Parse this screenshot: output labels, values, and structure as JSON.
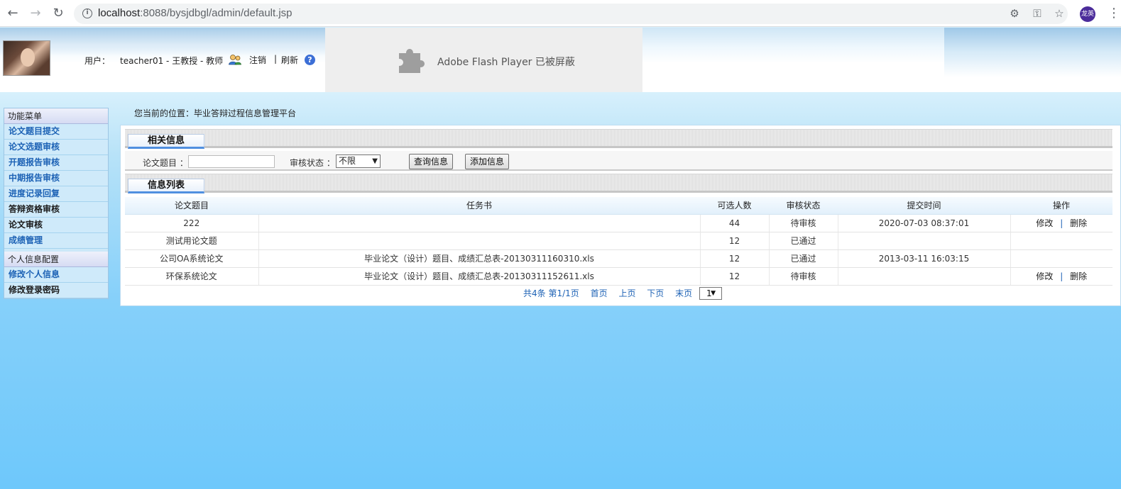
{
  "browser": {
    "url_host": "localhost",
    "url_rest": ":8088/bysjdbgl/admin/default.jsp",
    "profile_label": "龙英"
  },
  "header": {
    "user_label": "用户：",
    "user_name": "teacher01 - 王教授 - 教师",
    "logout": "注销",
    "separator": "|",
    "refresh": "刷新",
    "help": "?",
    "flash_message": "Adobe Flash Player 已被屏蔽"
  },
  "sidebar": {
    "sections": [
      {
        "title": "功能菜单",
        "items": [
          {
            "label": "论文题目提交",
            "style": "link"
          },
          {
            "label": "论文选题审核",
            "style": "link"
          },
          {
            "label": "开题报告审核",
            "style": "link"
          },
          {
            "label": "中期报告审核",
            "style": "link"
          },
          {
            "label": "进度记录回复",
            "style": "link"
          },
          {
            "label": "答辩资格审核",
            "style": "dark"
          },
          {
            "label": "论文审核",
            "style": "dark"
          },
          {
            "label": "成绩管理",
            "style": "link"
          }
        ]
      },
      {
        "title": "个人信息配置",
        "items": [
          {
            "label": "修改个人信息",
            "style": "link"
          },
          {
            "label": "修改登录密码",
            "style": "dark"
          }
        ]
      }
    ]
  },
  "breadcrumb": "您当前的位置：毕业答辩过程信息管理平台",
  "search": {
    "tab_title": "相关信息",
    "title_label": "论文题目 ：",
    "title_value": "",
    "status_label": "审核状态 ：",
    "status_value": "不限",
    "query_button": "查询信息",
    "add_button": "添加信息"
  },
  "list": {
    "tab_title": "信息列表",
    "columns": [
      "论文题目",
      "任务书",
      "可选人数",
      "审核状态",
      "提交时间",
      "操作"
    ],
    "rows": [
      {
        "title": "222",
        "task": "",
        "count": "44",
        "status": "待审核",
        "time": "2020-07-03 08:37:01",
        "edit": "修改",
        "sep": "|",
        "del": "删除"
      },
      {
        "title": "测试用论文题",
        "task": "",
        "count": "12",
        "status": "已通过",
        "time": "",
        "edit": "",
        "sep": "",
        "del": ""
      },
      {
        "title": "公司OA系统论文",
        "task": "毕业论文（设计）题目、成绩汇总表-20130311160310.xls",
        "count": "12",
        "status": "已通过",
        "time": "2013-03-11 16:03:15",
        "edit": "",
        "sep": "",
        "del": ""
      },
      {
        "title": "环保系统论文",
        "task": "毕业论文（设计）题目、成绩汇总表-20130311152611.xls",
        "count": "12",
        "status": "待审核",
        "time": "",
        "edit": "修改",
        "sep": "|",
        "del": "删除"
      }
    ]
  },
  "pager": {
    "summary": "共4条 第1/1页",
    "first": "首页",
    "prev": "上页",
    "next": "下页",
    "last": "末页",
    "page_select": "1"
  },
  "colors": {
    "link": "#1d62b5",
    "accent_tab": "#4f8fe0",
    "background": "#6ec8fb"
  }
}
